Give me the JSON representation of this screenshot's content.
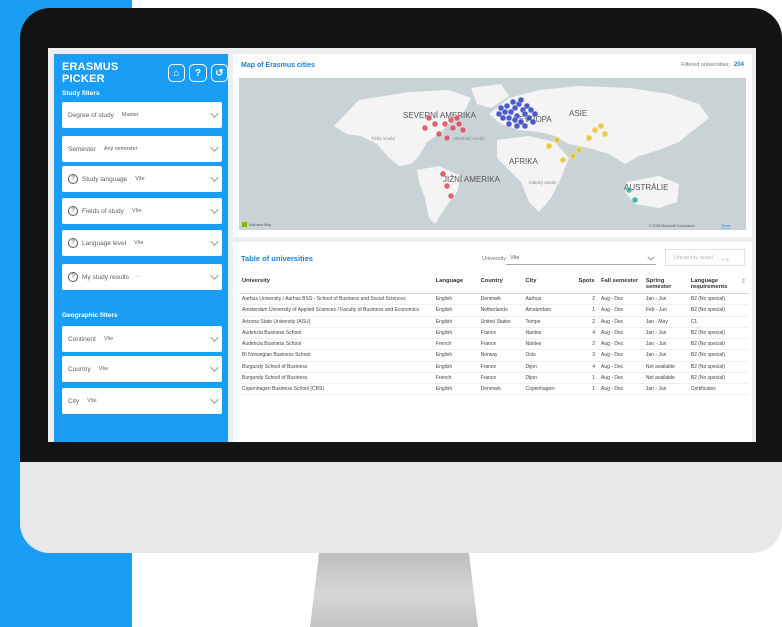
{
  "app": {
    "title": "ERASMUS PICKER",
    "buttons": {
      "home": "⌂",
      "help": "?",
      "reset": "↺"
    }
  },
  "study_filters": {
    "heading": "Study filters",
    "degree": {
      "label": "Degree of study",
      "value": "Master"
    },
    "semester": {
      "label": "Semester",
      "value": "Any semester"
    },
    "language": {
      "label": "Study language",
      "value": "Vše"
    },
    "fields": {
      "label": "Fields of study",
      "value": "Vše"
    },
    "level": {
      "label": "Language level",
      "value": "Vše"
    },
    "results": {
      "label": "My study results",
      "value": "-"
    }
  },
  "geo_filters": {
    "heading": "Geographic filters",
    "continent": {
      "label": "Continent",
      "value": "Vše"
    },
    "country": {
      "label": "Country",
      "value": "Vše"
    },
    "city": {
      "label": "City",
      "value": "Vše"
    }
  },
  "map": {
    "title": "Map of Erasmus cities",
    "filtered_label": "Filtered universities:",
    "filtered_count": "204",
    "labels": {
      "north_america": "SEVERNÍ AMERIKA",
      "pacific": "Tichý oceán",
      "atlantic": "Atlantský oceán",
      "europe": "EVROPA",
      "asia": "ASIE",
      "africa": "AFRIKA",
      "south_america": "JIŽNÍ AMERIKA",
      "indian": "Indický oceán",
      "australia": "AUSTRÁLIE"
    },
    "attribution_logo": "Microsoft Bing",
    "copyright": "© 2023 Microsoft Corporation",
    "terms": "Terms",
    "colors": {
      "europe": "#2b3fc4",
      "america": "#d94a5a",
      "asia": "#e7c02a",
      "oceania": "#2aa894",
      "land": "#f4f4f4",
      "sea": "#c9d3d6"
    }
  },
  "table": {
    "title": "Table of universities",
    "select_label": "University",
    "select_value": "Vše",
    "detail_button": "University detail",
    "columns": [
      "University",
      "Language",
      "Country",
      "City",
      "Spots",
      "Fall semester",
      "Spring semester",
      "Language requirements"
    ],
    "rows": [
      [
        "Aarhus University / Aarhus BSS - School of Business and Social Sciences",
        "English",
        "Denmark",
        "Aarhus",
        "2",
        "Aug - Dec",
        "Jan - Jun",
        "B2 (No special)"
      ],
      [
        "Amsterdam University of Applied Sciences / Faculty of Business and Economics",
        "English",
        "Netherlands",
        "Amsterdam",
        "1",
        "Aug - Dec",
        "Feb - Jun",
        "B2 (No special)"
      ],
      [
        "Arizona State University (ASU)",
        "English",
        "United States",
        "Tempe",
        "2",
        "Aug - Dec",
        "Jan - May",
        "C1"
      ],
      [
        "Audencia Business School",
        "English",
        "France",
        "Nantes",
        "4",
        "Aug - Dec",
        "Jan - Jun",
        "B2 (No special)"
      ],
      [
        "Audencia Business School",
        "French",
        "France",
        "Nantes",
        "2",
        "Aug - Dec",
        "Jan - Jun",
        "B2 (No special)"
      ],
      [
        "BI Norwegian Business School",
        "English",
        "Norway",
        "Oslo",
        "3",
        "Aug - Dec",
        "Jan - Jun",
        "B2 (No special)"
      ],
      [
        "Burgundy School of Business",
        "English",
        "France",
        "Dijon",
        "4",
        "Aug - Dec",
        "Not available",
        "B2 (No special)"
      ],
      [
        "Burgundy School of Business",
        "French",
        "France",
        "Dijon",
        "1",
        "Aug - Dec",
        "Not available",
        "B2 (No special)"
      ],
      [
        "Copenhagen Business School (CBS)",
        "English",
        "Denmark",
        "Copenhagen-",
        "1",
        "Aug - Dec",
        "Jan - Jun",
        "Certificates"
      ]
    ]
  }
}
